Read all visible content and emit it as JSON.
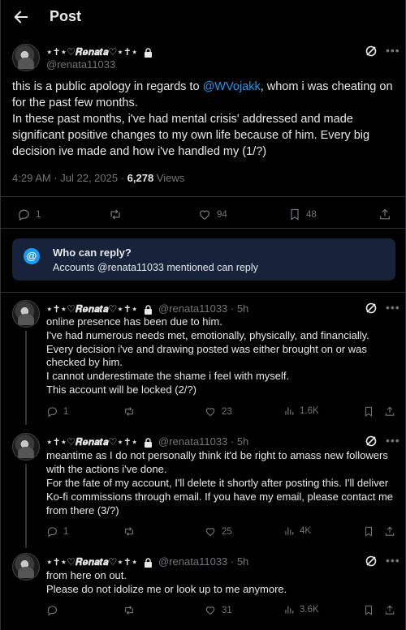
{
  "header": {
    "title": "Post"
  },
  "author": {
    "display_name": "⋆✝︎⋆♡𝑹𝒆𝒏𝒂𝒕𝒂♡⋆✝︎⋆",
    "handle": "@renata11033"
  },
  "main_post": {
    "text_before_mention": "this is a public apology in regards to ",
    "mention": "@WVojakk",
    "text_after_mention": ", whom i was cheating on for the past few months.",
    "text_paragraph_2": "In these past months, i've had mental crisis' addressed and made significant positive changes to my own life because of him. Every big decision ive made and how i've handled my (1/?)",
    "time": "4:29 AM · Jul 22, 2025 · ",
    "views": "6,278",
    "views_label": " Views",
    "replies": "1",
    "reposts": "",
    "likes": "94",
    "bookmarks": "48"
  },
  "who_can_reply": {
    "title": "Who can reply?",
    "subtitle": "Accounts @renata11033 mentioned can reply",
    "icon": "@"
  },
  "replies": [
    {
      "handle_time": "@renata11033 · 5h",
      "lines": [
        "online presence has been due to him.",
        "I've had numerous needs met, emotionally, physically, and financially.",
        "Every decision i've and drawing posted was either brought on or was",
        "checked by him.",
        "I cannot underestimate the shame i feel with myself.",
        "This account will be locked (2/?)"
      ],
      "replies": "1",
      "likes": "23",
      "views": "1.6K"
    },
    {
      "handle_time": "@renata11033 · 5h",
      "lines": [
        "meantime as I do not personally think it'd be right to amass new followers",
        "with the actions i've done.",
        "For the fate of my account, I'll delete it shortly after posting this. I'll deliver",
        "Ko-fi commissions through email. If you have my email, please contact me",
        "from there (3/?)"
      ],
      "replies": "1",
      "likes": "25",
      "views": "4K"
    },
    {
      "handle_time": "@renata11033 · 5h",
      "lines": [
        "from here on out.",
        "Please do not idolize me or look up to me anymore."
      ],
      "replies": "",
      "likes": "31",
      "views": "3.6K"
    }
  ],
  "icons": {
    "back": "arrow-left-icon",
    "grok": "grok-icon",
    "more": "more-icon",
    "lock": "lock-icon",
    "reply": "reply-icon",
    "repost": "repost-icon",
    "like": "like-icon",
    "bookmark": "bookmark-icon",
    "share": "share-icon",
    "views": "views-icon"
  },
  "colors": {
    "background": "#000000",
    "text": "#e7e9ea",
    "muted": "#71767b",
    "accent": "#1d9bf0",
    "who_bg": "#16233a"
  }
}
